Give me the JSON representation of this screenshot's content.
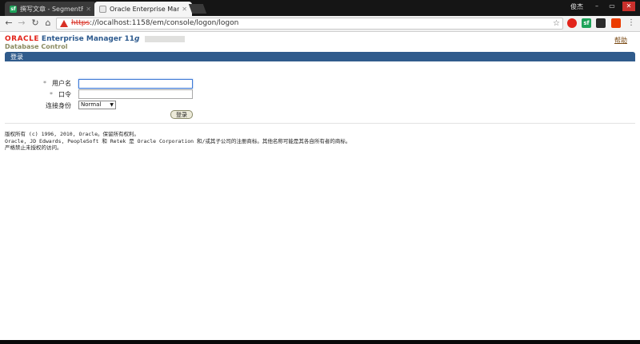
{
  "browser": {
    "tabs": [
      {
        "title": "撰写文章 - SegmentFa",
        "favicon": "sf"
      },
      {
        "title": "Oracle Enterprise Man",
        "favicon": "doc"
      }
    ],
    "window_user": "俊杰",
    "window_controls": {
      "minimize": "–",
      "restore": "▭",
      "close": "✕"
    },
    "nav": {
      "back": "←",
      "forward": "→",
      "reload": "↻",
      "home": "⌂"
    },
    "url": {
      "scheme": "https",
      "rest": "://localhost:1158/em/console/logon/logon"
    },
    "star": "☆",
    "extensions": [
      {
        "label": "",
        "color": "#e2231a"
      },
      {
        "label": "sf",
        "color": "#1ea35a"
      },
      {
        "label": "",
        "color": "#2a2a2a"
      },
      {
        "label": "",
        "color": "#eb3c00"
      }
    ]
  },
  "header": {
    "brand": "ORACLE",
    "product": "Enterprise Manager 11",
    "version_suffix": "g",
    "subtitle": "Database Control",
    "help_link": "帮助"
  },
  "login_panel": {
    "title": "登录",
    "required_mark": "*",
    "username_label": "用户名",
    "username_value": "",
    "password_label": "口令",
    "password_value": "",
    "connect_as_label": "连接身份",
    "connect_as_value": "Normal",
    "login_button": "登录"
  },
  "footer": {
    "line1": "版权所有 (c) 1996, 2010, Oracle。保留所有权利。",
    "line2": "Oracle, JD Edwards, PeopleSoft 和 Retek 是 Oracle Corporation 和/或其子公司的注册商标。其他名称可能是其各自所有者的商标。",
    "line3": "严格禁止未授权的访问。"
  }
}
